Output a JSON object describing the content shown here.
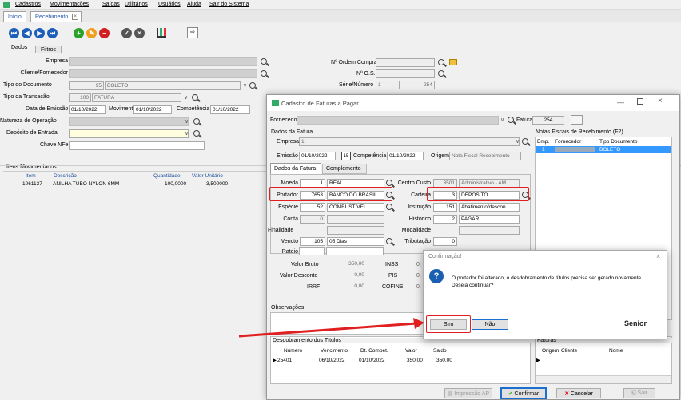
{
  "menu": [
    "Cadastros",
    "Movimentações",
    "Saídas",
    "Utilitários",
    "Usuários",
    "Ajuda",
    "Sair do Sistema"
  ],
  "tabs": [
    "Início",
    "Recebimento"
  ],
  "subtabs": [
    "Dados",
    "Filtros"
  ],
  "main": {
    "empresa": "Empresa",
    "cliente": "Cliente/Fornecedor",
    "tipo_doc": "Tipo do Documento",
    "tipo_doc_val": "95",
    "tipo_doc_txt": "BOLETO",
    "tipo_trans": "Tipo da Transação",
    "tipo_trans_val": "100",
    "tipo_trans_txt": "FATURA",
    "data_emissao": "Data de Emissão",
    "data_emissao_val": "01/10/2022",
    "movimento": "Movimento",
    "movimento_val": "01/10/2022",
    "competencia": "Competência",
    "competencia_val": "01/10/2022",
    "natureza": "Natureza de Operação",
    "deposito": "Depósito de Entrada",
    "chave": "Chave NFe",
    "ordem": "Nº Ordem Compra",
    "os": "Nº O.S.",
    "serie": "Série/Número",
    "serie_val": "1",
    "numero_val": "254",
    "itens": "Itens Movimentados",
    "itens_cols": [
      "Item",
      "Descrição",
      "Quantidade",
      "Valor Unitário"
    ],
    "itens_row": [
      "1061137",
      "ANILHA TUBO NYLON 6MM",
      "100,0000",
      "3,500000"
    ]
  },
  "fatura_win": {
    "title": "Cadastro de Faturas a Pagar",
    "fornecedor": "Fornecedor",
    "fatura": "Fatura",
    "fatura_val": "254",
    "dados_fatura": "Dados da Fatura",
    "empresa": "Empresa",
    "empresa_val": "1",
    "emissao": "Emissão",
    "emissao_val": "01/10/2022",
    "competencia": "Competência",
    "competencia_val": "01/10/2022",
    "origem": "Origem",
    "origem_val": "Nota Fiscal Recebimento",
    "tabs": [
      "Dados da Fatura",
      "Complemento"
    ],
    "moeda": "Moeda",
    "moeda_val": "1",
    "moeda_txt": "REAL",
    "portador": "Portador",
    "portador_val": "7653",
    "portador_txt": "BANCO DO BRASIL",
    "especie": "Espécie",
    "especie_val": "52",
    "especie_txt": "COMBUSTÍVEL",
    "conta": "Conta",
    "conta_val": "0",
    "finalidade": "Finalidade",
    "vencto": "Vencto",
    "vencto_val": "105",
    "vencto_txt": "05 Dias",
    "rateio": "Rateio",
    "centro": "Centro Custo",
    "centro_val": "3501",
    "centro_txt": "Administrativo - AM",
    "carteira": "Carteira",
    "carteira_val": "3",
    "carteira_txt": "DEPOSITO",
    "instrucao": "Instrução",
    "instrucao_val": "151",
    "instrucao_txt": "Abatimento/descon",
    "historico": "Histórico",
    "historico_val": "2",
    "historico_txt": "PAGAR",
    "modalidade": "Modalidade",
    "tributacao": "Tributação",
    "tributacao_val": "0",
    "valor_bruto": "Valor Bruto",
    "valor_bruto_val": "350,00",
    "valor_desconto": "Valor Desconto",
    "valor_desconto_val": "0,00",
    "irrf": "IRRF",
    "irrf_val": "0,00",
    "inss": "INSS",
    "inss_val": "0,",
    "pis": "PIS",
    "pis_val": "0,",
    "cofins": "COFINS",
    "cofins_val": "0,",
    "observacoes": "Observações",
    "notas": "Notas Fiscais de Recebimento (F2)",
    "notas_cols": [
      "Emp.",
      "Fornecedor",
      "Tipo Documento"
    ],
    "notas_row": [
      "1",
      "",
      "BOLETO"
    ],
    "desdobramento": "Desdobramento dos Títulos",
    "desd_cols": [
      "Número",
      "Vencimento",
      "Dt. Compet.",
      "Valor",
      "Saldo"
    ],
    "desd_row": [
      "25401",
      "06/10/2022",
      "01/10/2022",
      "350,00",
      "350,00"
    ],
    "faturas": "Faturas",
    "faturas_cols": [
      "Origem",
      "Cliente",
      "Nome"
    ],
    "impressao": "Impressão AP",
    "confirmar": "Confirmar",
    "cancelar": "Cancelar",
    "sair": "Sair"
  },
  "dialog": {
    "title": "Confirmação!",
    "message1": "O portador foi alterado, o desdobramento de títulos precisa ser gerado novamente",
    "message2": "Deseja continuar?",
    "yes": "Sim",
    "no": "Não",
    "brand": "Senior"
  }
}
